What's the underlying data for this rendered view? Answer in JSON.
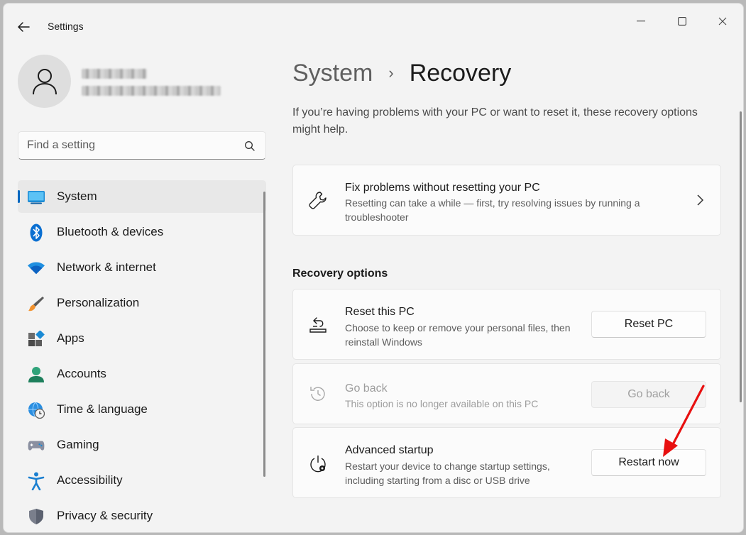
{
  "window": {
    "title": "Settings"
  },
  "sidebar": {
    "search_placeholder": "Find a setting",
    "items": [
      {
        "label": "System",
        "icon": "system-monitor-icon",
        "active": true
      },
      {
        "label": "Bluetooth & devices",
        "icon": "bluetooth-icon"
      },
      {
        "label": "Network & internet",
        "icon": "wifi-icon"
      },
      {
        "label": "Personalization",
        "icon": "paintbrush-icon"
      },
      {
        "label": "Apps",
        "icon": "apps-icon"
      },
      {
        "label": "Accounts",
        "icon": "person-icon"
      },
      {
        "label": "Time & language",
        "icon": "globe-clock-icon"
      },
      {
        "label": "Gaming",
        "icon": "gamepad-icon"
      },
      {
        "label": "Accessibility",
        "icon": "accessibility-icon"
      },
      {
        "label": "Privacy & security",
        "icon": "shield-icon"
      }
    ]
  },
  "main": {
    "breadcrumb": {
      "parent": "System",
      "separator": "›",
      "current": "Recovery"
    },
    "intro": "If you’re having problems with your PC or want to reset it, these recovery options might help.",
    "fix_card": {
      "title": "Fix problems without resetting your PC",
      "description": "Resetting can take a while — first, try resolving issues by running a troubleshooter"
    },
    "section_title": "Recovery options",
    "options": [
      {
        "title": "Reset this PC",
        "description": "Choose to keep or remove your personal files, then reinstall Windows",
        "button": "Reset PC",
        "enabled": true
      },
      {
        "title": "Go back",
        "description": "This option is no longer available on this PC",
        "button": "Go back",
        "enabled": false
      },
      {
        "title": "Advanced startup",
        "description": "Restart your device to change startup settings, including starting from a disc or USB drive",
        "button": "Restart now",
        "enabled": true
      }
    ]
  },
  "colors": {
    "accent": "#0067c0",
    "annotation_arrow": "#e81010"
  }
}
